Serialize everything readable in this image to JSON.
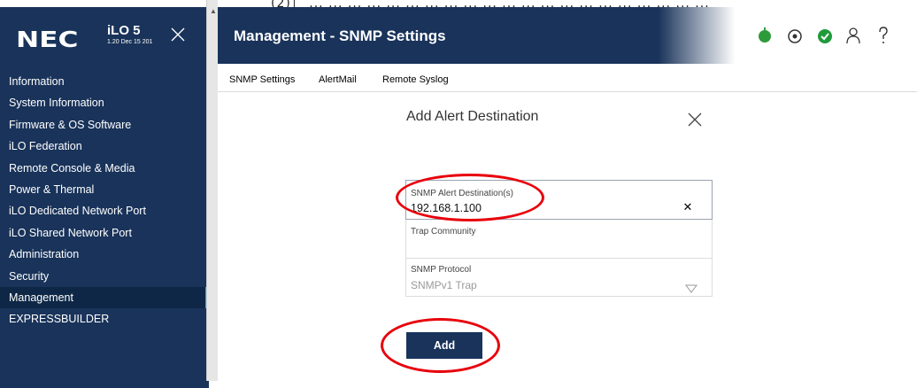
{
  "top_strip": {
    "text": "(2)］ ... ... ... ... ... ... ... ... ... ... ... ... ... ... ... ... ... ... ... ... ..."
  },
  "brand": {
    "logo_text": "NEC",
    "product": "iLO 5",
    "version": "1.20 Dec 15 201"
  },
  "sidebar": {
    "items": [
      {
        "label": "Information",
        "active": false
      },
      {
        "label": "System Information",
        "active": false
      },
      {
        "label": "Firmware & OS Software",
        "active": false
      },
      {
        "label": "iLO Federation",
        "active": false
      },
      {
        "label": "Remote Console & Media",
        "active": false
      },
      {
        "label": "Power & Thermal",
        "active": false
      },
      {
        "label": "iLO Dedicated Network Port",
        "active": false
      },
      {
        "label": "iLO Shared Network Port",
        "active": false
      },
      {
        "label": "Administration",
        "active": false
      },
      {
        "label": "Security",
        "active": false
      },
      {
        "label": "Management",
        "active": true
      },
      {
        "label": "EXPRESSBUILDER",
        "active": false
      }
    ]
  },
  "header": {
    "title": "Management - SNMP Settings",
    "icons": [
      "power-status-icon",
      "locator-target-icon",
      "health-ok-icon",
      "user-icon",
      "help-icon"
    ],
    "colors": {
      "nav_bg": "#19335a",
      "power_green": "#2e9b3b",
      "health_green": "#1f9a3a"
    }
  },
  "tabs": [
    {
      "label": "SNMP Settings"
    },
    {
      "label": "AlertMail"
    },
    {
      "label": "Remote Syslog"
    }
  ],
  "dialog": {
    "title": "Add Alert Destination",
    "destination": {
      "label": "SNMP Alert Destination(s)",
      "value": "192.168.1.100"
    },
    "community": {
      "label": "Trap Community",
      "value": ""
    },
    "protocol": {
      "label": "SNMP Protocol",
      "value": "SNMPv1 Trap"
    },
    "add_label": "Add"
  },
  "annotations": {
    "color": "#e8000b"
  }
}
